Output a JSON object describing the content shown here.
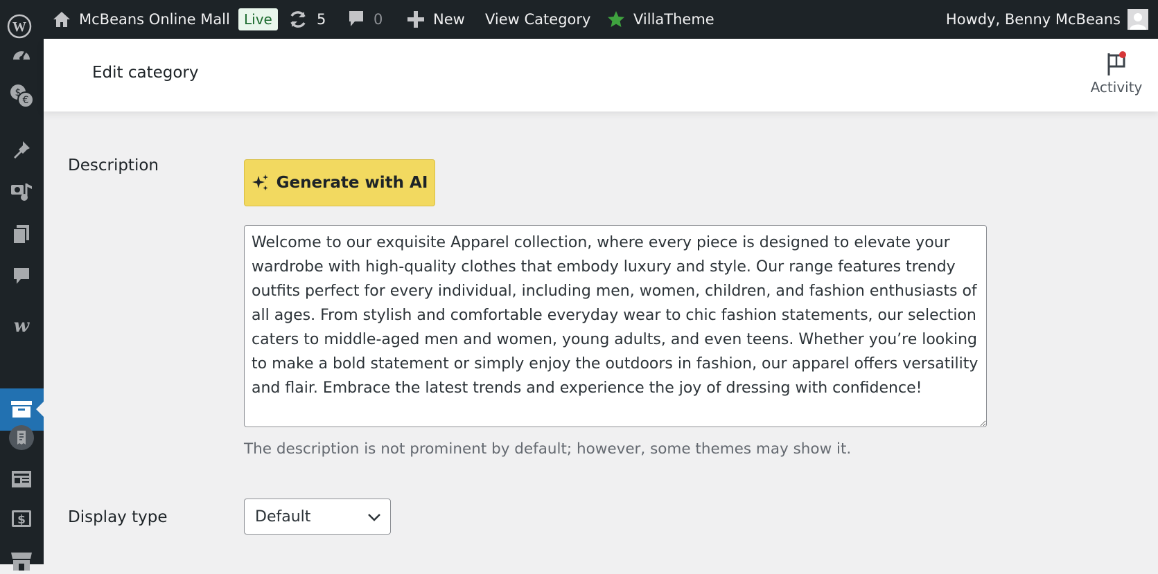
{
  "admin_bar": {
    "site_name": "McBeans Online Mall",
    "live_badge": "Live",
    "updates_count": "5",
    "comments_count": "0",
    "new_label": "New",
    "view_category_label": "View Category",
    "villatheme_label": "VillaTheme",
    "howdy_text": "Howdy, Benny McBeans"
  },
  "sidebar": {
    "icons": [
      "dashboard-icon",
      "currency-icon",
      "pin-icon",
      "media-icon",
      "pages-icon",
      "comments-icon",
      "woo-icon",
      "archive-icon",
      "receipt-icon",
      "layout-icon",
      "dollar-icon",
      "store-icon"
    ],
    "current_item": "archive-icon"
  },
  "header": {
    "title": "Edit category",
    "activity_label": "Activity"
  },
  "form": {
    "description_label": "Description",
    "ai_button_label": "Generate with AI",
    "description_value": "Welcome to our exquisite Apparel collection, where every piece is designed to elevate your wardrobe with high-quality clothes that embody luxury and style. Our range features trendy outfits perfect for every individual, including men, women, children, and fashion enthusiasts of all ages. From stylish and comfortable everyday wear to chic fashion statements, our selection caters to middle-aged men and women, young adults, and even teens. Whether you’re looking to make a bold statement or simply enjoy the outdoors in fashion, our apparel offers versatility and flair. Embrace the latest trends and experience the joy of dressing with confidence!",
    "description_help": "The description is not prominent by default; however, some themes may show it.",
    "display_type_label": "Display type",
    "display_type_value": "Default"
  },
  "colors": {
    "admin_bar_bg": "#1d2327",
    "accent": "#2271b1",
    "ai_button_bg": "#f2d960",
    "villatheme_star": "#3fa33f",
    "notification_dot": "#d63638"
  }
}
